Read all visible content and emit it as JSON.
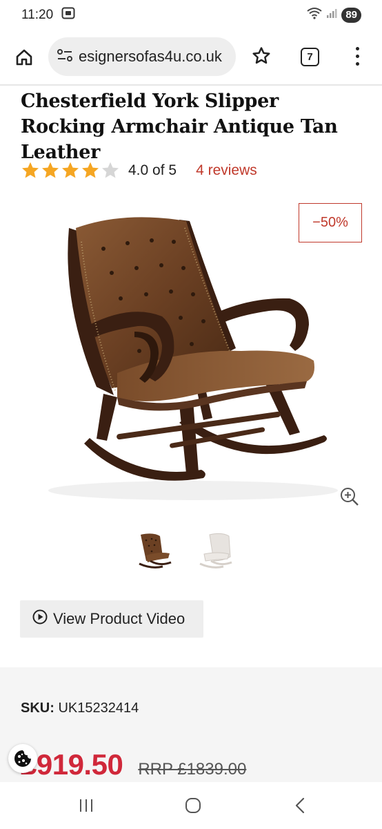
{
  "status_bar": {
    "time": "11:20",
    "battery": "89"
  },
  "browser": {
    "url": "esignersofas4u.co.uk",
    "tab_count": "7"
  },
  "product": {
    "title": "Chesterfield York Slipper Rocking Armchair Antique Tan Leather",
    "rating_value": 4.0,
    "rating_max": 5,
    "rating_text": "4.0 of 5",
    "reviews_text": "4 reviews",
    "discount_badge": "−50%",
    "video_button_label": "View Product Video",
    "sku_label": "SKU:",
    "sku_value": "UK15232414",
    "price_current": "£919.50",
    "price_rrp": "RRP £1839.00"
  },
  "colors": {
    "accent_red": "#c0392b",
    "price_red": "#d0283a",
    "star_gold": "#f5a623",
    "star_empty": "#d6d6d6"
  },
  "icons": {
    "home": "home-icon",
    "site_settings": "site-settings-icon",
    "bookmark": "star-icon",
    "tabs": "tab-switcher-icon",
    "menu": "kebab-menu-icon",
    "zoom": "zoom-in-icon",
    "play": "play-circle-icon",
    "cookie": "cookie-icon"
  }
}
